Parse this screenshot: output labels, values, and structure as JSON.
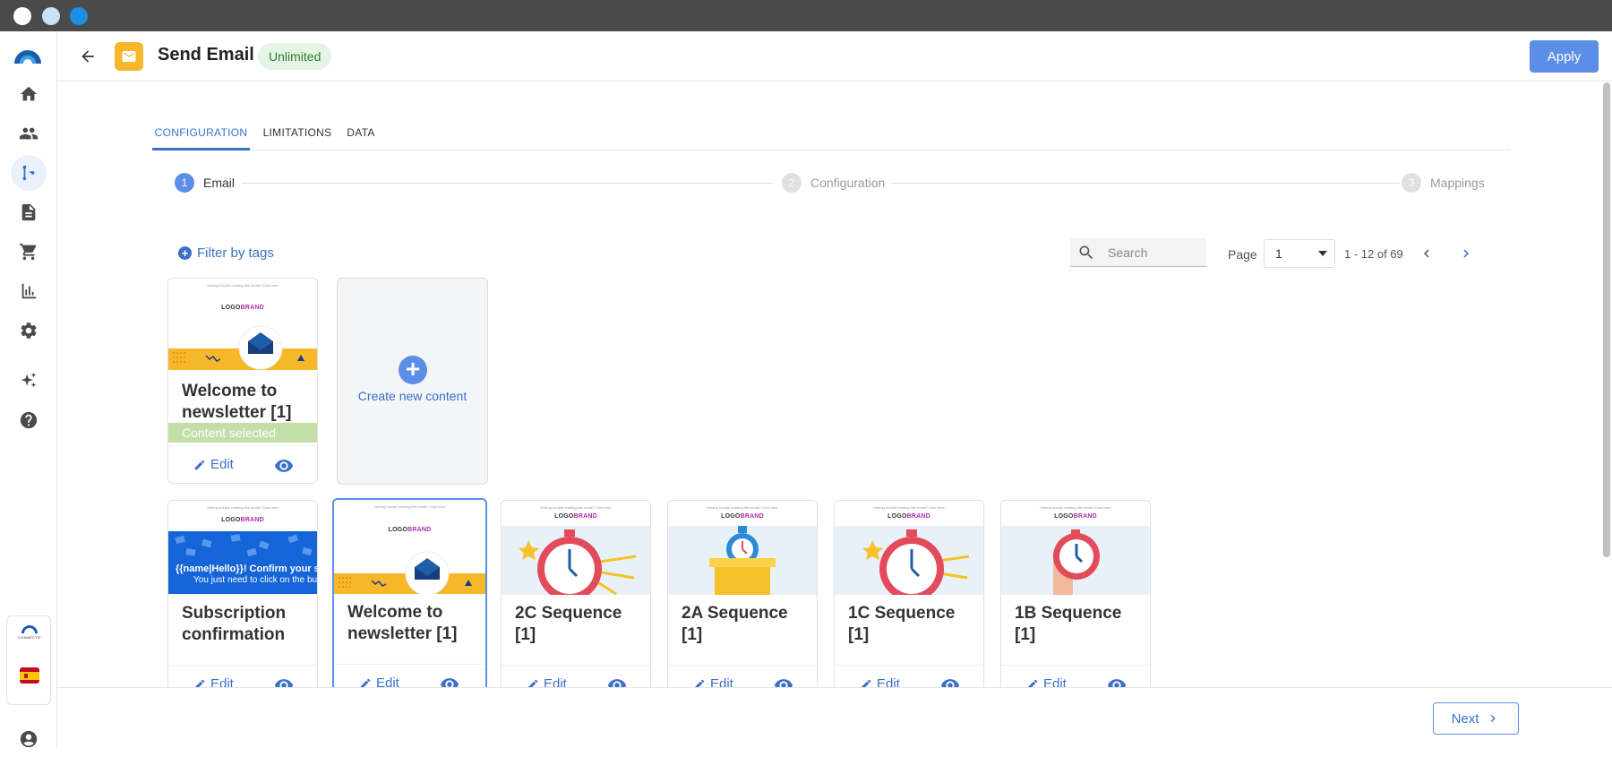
{
  "colors": {
    "accent": "#5b8ee6",
    "selected_band": "#c3dfa8",
    "badge_bg": "#e5f5e5",
    "mail_tile": "#f6b72a"
  },
  "header": {
    "title": "Send Email",
    "badge": "Unlimited",
    "apply_label": "Apply"
  },
  "tabs": [
    {
      "label": "CONFIGURATION"
    },
    {
      "label": "LIMITATIONS"
    },
    {
      "label": "DATA"
    }
  ],
  "stepper": [
    {
      "num": "1",
      "label": "Email"
    },
    {
      "num": "2",
      "label": "Configuration"
    },
    {
      "num": "3",
      "label": "Mappings"
    }
  ],
  "toolbar": {
    "filter_label": "Filter by tags",
    "search_placeholder": "Search",
    "page_label": "Page",
    "page_value": "1",
    "range": "1 - 12 of 69"
  },
  "create": {
    "label": "Create new content"
  },
  "cards": [
    {
      "title": "Welcome to newsletter [1]",
      "selected_text": "Content selected",
      "edit": "Edit"
    },
    {
      "title": "Subscription confirmation",
      "edit": "Edit",
      "banner_line1": "{{name|Hello}}! Confirm your subscr",
      "banner_line2": "You just need to click on the butto"
    },
    {
      "title": "Welcome to newsletter [1]",
      "edit": "Edit"
    },
    {
      "title": "2C Sequence [1]",
      "edit": "Edit"
    },
    {
      "title": "2A Sequence [1]",
      "edit": "Edit"
    },
    {
      "title": "1C Sequence [1]",
      "edit": "Edit"
    },
    {
      "title": "1B Sequence [1]",
      "edit": "Edit"
    }
  ],
  "thumb": {
    "tiny": "Having trouble reading this email? Click here",
    "logo_a": "LOGO",
    "logo_b": "BRAND"
  },
  "footer": {
    "next_label": "Next"
  },
  "brand": {
    "mini_label": "CONNECTIF"
  }
}
